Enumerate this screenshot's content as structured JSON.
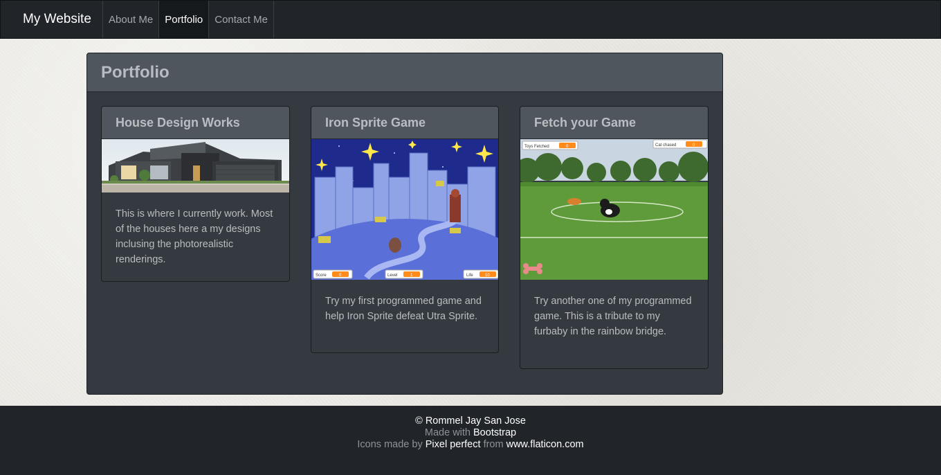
{
  "navbar": {
    "brand": "My Website",
    "links": [
      {
        "label": "About Me",
        "active": false
      },
      {
        "label": "Portfolio",
        "active": true
      },
      {
        "label": "Contact Me",
        "active": false
      }
    ]
  },
  "portfolio": {
    "title": "Portfolio",
    "cards": [
      {
        "title": "House Design Works",
        "image": "modern-house-photo",
        "text": "This is where I currently work. Most of the houses here a my designs inclusing the photorealistic renderings."
      },
      {
        "title": "Iron Sprite Game",
        "image": "iron-sprite-game-screenshot",
        "hud": [
          {
            "label": "Score",
            "value": "0"
          },
          {
            "label": "Level",
            "value": "1"
          },
          {
            "label": "Life",
            "value": "10"
          }
        ],
        "text": "Try my first programmed game and help Iron Sprite defeat Utra Sprite."
      },
      {
        "title": "Fetch your Game",
        "image": "fetch-game-screenshot",
        "hud": [
          {
            "label": "Toys Fetched",
            "value": "0"
          },
          {
            "label": "Cat chased",
            "value": "0"
          }
        ],
        "text": "Try another one of my programmed game. This is a tribute to my furbaby in the rainbow bridge."
      }
    ]
  },
  "footer": {
    "copyright": "© Rommel Jay San Jose",
    "made_with_prefix": "Made with",
    "made_with_link": "Bootstrap",
    "icons_prefix": "Icons made by",
    "icons_author": "Pixel perfect",
    "icons_from": "from",
    "icons_site": "www.flaticon.com"
  }
}
